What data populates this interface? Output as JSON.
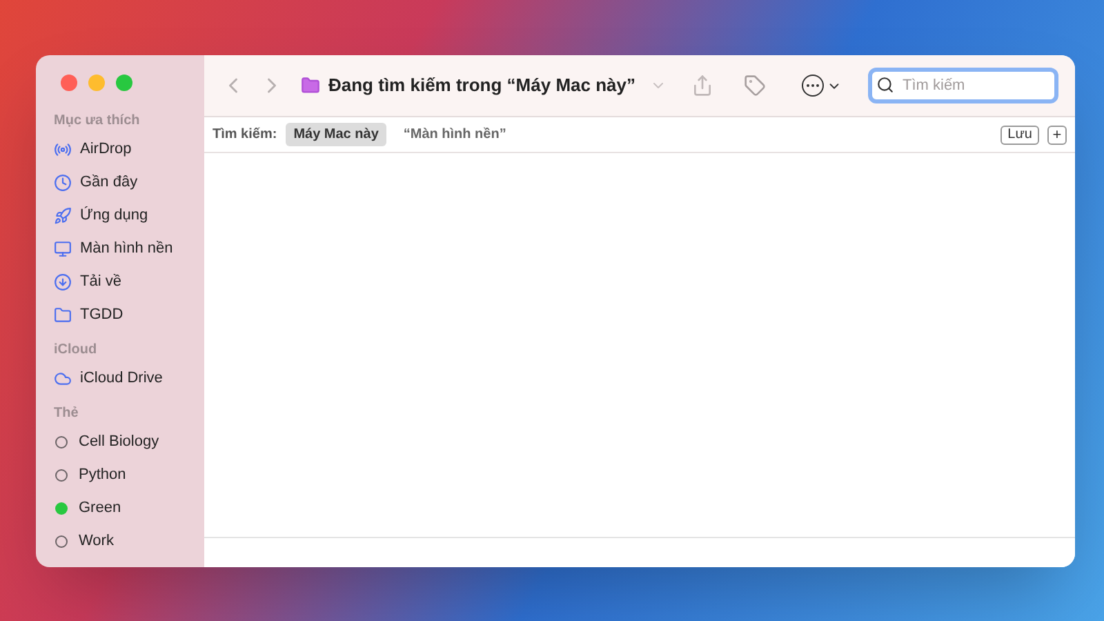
{
  "window": {
    "title": "Đang tìm kiếm trong “Máy Mac này”"
  },
  "sidebar": {
    "sections": [
      {
        "heading": "Mục ưa thích",
        "items": [
          {
            "label": "AirDrop"
          },
          {
            "label": "Gần đây"
          },
          {
            "label": "Ứng dụng"
          },
          {
            "label": "Màn hình nền"
          },
          {
            "label": "Tải về"
          },
          {
            "label": "TGDD"
          }
        ]
      },
      {
        "heading": "iCloud",
        "items": [
          {
            "label": "iCloud Drive"
          }
        ]
      }
    ],
    "tags": {
      "heading": "Thẻ",
      "items": [
        {
          "label": "Cell Biology"
        },
        {
          "label": "Python"
        },
        {
          "label": "Green",
          "color": "#28c840"
        },
        {
          "label": "Work"
        }
      ]
    }
  },
  "search": {
    "placeholder": "Tìm kiếm"
  },
  "scope_bar": {
    "label": "Tìm kiếm:",
    "scopes": [
      {
        "label": "Máy Mac này",
        "selected": true
      },
      {
        "label": "“Màn hình nền”",
        "selected": false
      }
    ],
    "save_button": "Lưu",
    "add_button": "+"
  }
}
